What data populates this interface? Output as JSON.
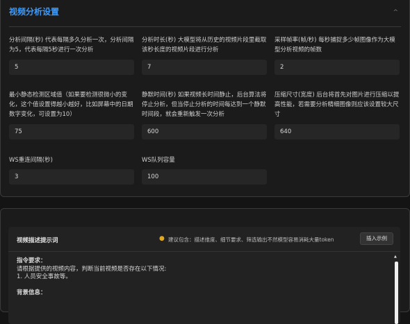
{
  "video_analysis": {
    "title": "视频分析设置",
    "fields": [
      {
        "label": "分析间隔(秒) 代表每隔多久分析一次，分析间隔为5，代表每隔5秒进行一次分析",
        "value": "5"
      },
      {
        "label": "分析时长(秒) 大模型将从历史的视频片段里截取该秒长度的视频片段进行分析",
        "value": "7"
      },
      {
        "label": "采样帧率(帧/秒) 每秒捕捉多少帧图像作为大模型分析视频的帧数",
        "value": "2"
      },
      {
        "label": "最小静态检测区域值（如果要检测很微小的变化，这个值设置得越小越好，比如屏幕中的日期数字变化，可设置为10）",
        "value": "75"
      },
      {
        "label": "静默时间(秒) 如果视频长时间静止，后台算法将停止分析，但当停止分析的时间每达到一个静默时间段，就会重新触发一次分析",
        "value": "600"
      },
      {
        "label": "压缩尺寸(宽度) 后台将首先对图片进行压缩以提高性能，若需要分析精细图像则应该设置较大尺寸",
        "value": "640"
      },
      {
        "label": "WS重连间隔(秒)",
        "value": "3"
      },
      {
        "label": "WS队列容量",
        "value": "100"
      }
    ]
  },
  "prompt_section": {
    "title": "视频描述提示词",
    "tip": "建议包含：描述维度、细节要求、筛选输出不然模型容易消耗大量token",
    "insert_button": "插入示例",
    "lines": [
      "指令要求：",
      "请根据提供的视频内容，判断当前视频是否存在以下情况:",
      "1. 人员安全事故等。",
      "",
      "背景信息："
    ]
  },
  "icons": {
    "collapse": "chevron-up-icon",
    "tip": "lightbulb-icon"
  }
}
